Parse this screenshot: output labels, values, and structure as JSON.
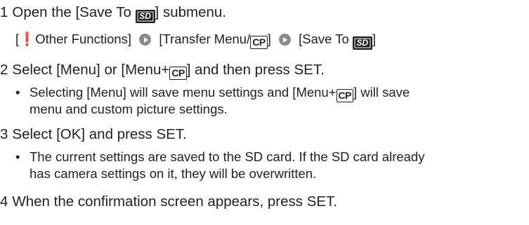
{
  "steps": [
    {
      "number": "1",
      "before_icon": "Open the [Save To ",
      "icon": "save-to-sd-icon",
      "after_icon": "] submenu.",
      "menu_path": {
        "open_bracket": "[",
        "other_functions": " Other Functions]",
        "transfer_menu_before": "[Transfer Menu/",
        "transfer_menu_after": "]",
        "save_to_before": "[Save To ",
        "save_to_after": "]"
      }
    },
    {
      "number": "2",
      "text_a": "Select [Menu] or [Menu+",
      "text_b": "] and then press SET.",
      "bullet_line1_a": "Selecting [Menu] will save menu settings and [Menu+",
      "bullet_line1_b": "] will save",
      "bullet_line2": "menu and custom picture settings."
    },
    {
      "number": "3",
      "text": "Select [OK] and press SET.",
      "bullet_line1": "The current settings are saved to the SD card. If the SD card already",
      "bullet_line2": "has camera settings on it, they will be overwritten."
    },
    {
      "number": "4",
      "text": "When the confirmation screen appears, press SET."
    }
  ],
  "icons": {
    "cp_label": "CP",
    "sd_label": "SD",
    "wrench": "wrench-icon",
    "arrow": "arrow-right-circle-icon",
    "bullet": "•"
  },
  "colors": {
    "text": "#231f20",
    "arrow_circle": "#8a8a8a"
  }
}
